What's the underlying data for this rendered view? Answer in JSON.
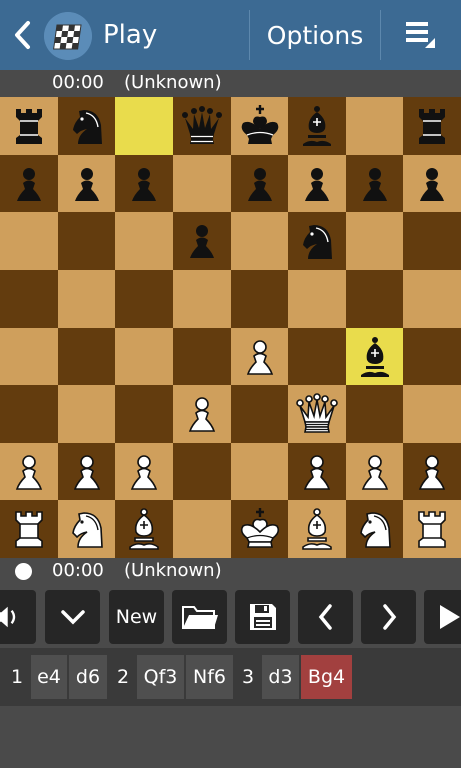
{
  "app": {
    "title": "Play",
    "options_label": "Options"
  },
  "icons": {
    "back": "chevron-left-icon",
    "logo": "chessboard-logo-icon",
    "menu": "overflow-menu-icon",
    "sound": "speaker-icon",
    "dropdown": "chevron-down-icon",
    "open": "folder-icon",
    "save": "floppy-disk-icon",
    "prev": "chevron-left-icon",
    "next": "chevron-right-icon",
    "play": "play-icon"
  },
  "colors": {
    "actionbar": "#3c6a93",
    "light_square": "#cf9f5c",
    "dark_square": "#633c0e",
    "highlight": "#e9dc4c",
    "current_move": "#a2403f"
  },
  "top_player": {
    "clock": "00:00",
    "name": "(Unknown)"
  },
  "bottom_player": {
    "clock": "00:00",
    "name": "(Unknown)"
  },
  "toolbar": {
    "new_label": "New"
  },
  "highlight_squares": [
    "c8",
    "g4"
  ],
  "board": [
    [
      "r",
      "n",
      "",
      "q",
      "k",
      "b",
      "",
      "r"
    ],
    [
      "p",
      "p",
      "p",
      "",
      "p",
      "p",
      "p",
      "p"
    ],
    [
      "",
      "",
      "",
      "p",
      "",
      "n",
      "",
      ""
    ],
    [
      "",
      "",
      "",
      "",
      "",
      "",
      "",
      ""
    ],
    [
      "",
      "",
      "",
      "",
      "P",
      "",
      "b",
      ""
    ],
    [
      "",
      "",
      "",
      "P",
      "",
      "Q",
      "",
      ""
    ],
    [
      "P",
      "P",
      "P",
      "",
      "",
      "P",
      "P",
      "P"
    ],
    [
      "R",
      "N",
      "B",
      "",
      "K",
      "B",
      "N",
      "R"
    ]
  ],
  "moves": {
    "n1": "1",
    "m1w": "e4",
    "m1b": "d6",
    "n2": "2",
    "m2w": "Qf3",
    "m2b": "Nf6",
    "n3": "3",
    "m3w": "d3",
    "m3b": "Bg4"
  }
}
